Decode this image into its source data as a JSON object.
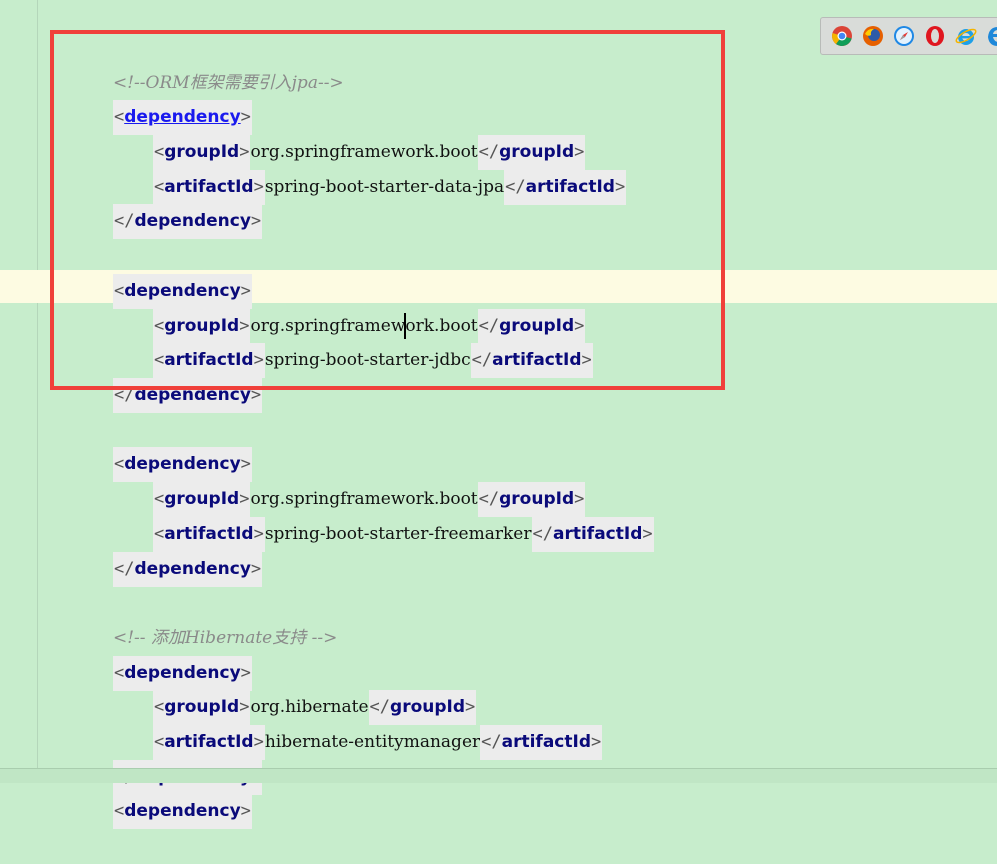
{
  "colors": {
    "background": "#c7edcc",
    "highlight_box": "#f0403a",
    "caret_line": "#fdfbe2"
  },
  "lines": [
    {
      "kind": "comment",
      "text": "<!--ORM框架需要引入jpa-->"
    },
    {
      "kind": "open",
      "tag": "dependency"
    },
    {
      "kind": "elem",
      "tag": "groupId",
      "value": "org.springframework.boot"
    },
    {
      "kind": "elem",
      "tag": "artifactId",
      "value": "spring-boot-starter-data-jpa"
    },
    {
      "kind": "close",
      "tag": "dependency"
    },
    {
      "kind": "open",
      "tag": "dependency"
    },
    {
      "kind": "elem",
      "tag": "groupId",
      "value_a": "org.springframew",
      "value_b": "ork.boot"
    },
    {
      "kind": "elem",
      "tag": "artifactId",
      "value": "spring-boot-starter-jdbc"
    },
    {
      "kind": "close",
      "tag": "dependency"
    },
    {
      "kind": "open",
      "tag": "dependency"
    },
    {
      "kind": "elem",
      "tag": "groupId",
      "value": "org.springframework.boot"
    },
    {
      "kind": "elem",
      "tag": "artifactId",
      "value": "spring-boot-starter-freemarker"
    },
    {
      "kind": "close",
      "tag": "dependency"
    },
    {
      "kind": "comment",
      "text": "<!-- 添加Hibernate支持 -->"
    },
    {
      "kind": "open",
      "tag": "dependency"
    },
    {
      "kind": "elem",
      "tag": "groupId",
      "value": "org.hibernate"
    },
    {
      "kind": "elem",
      "tag": "artifactId",
      "value": "hibernate-entitymanager"
    },
    {
      "kind": "close",
      "tag": "dependency"
    },
    {
      "kind": "open",
      "tag": "dependency"
    }
  ],
  "browser_icons": [
    "chrome-icon",
    "firefox-icon",
    "safari-icon",
    "opera-icon",
    "ie-icon",
    "edge-icon"
  ]
}
